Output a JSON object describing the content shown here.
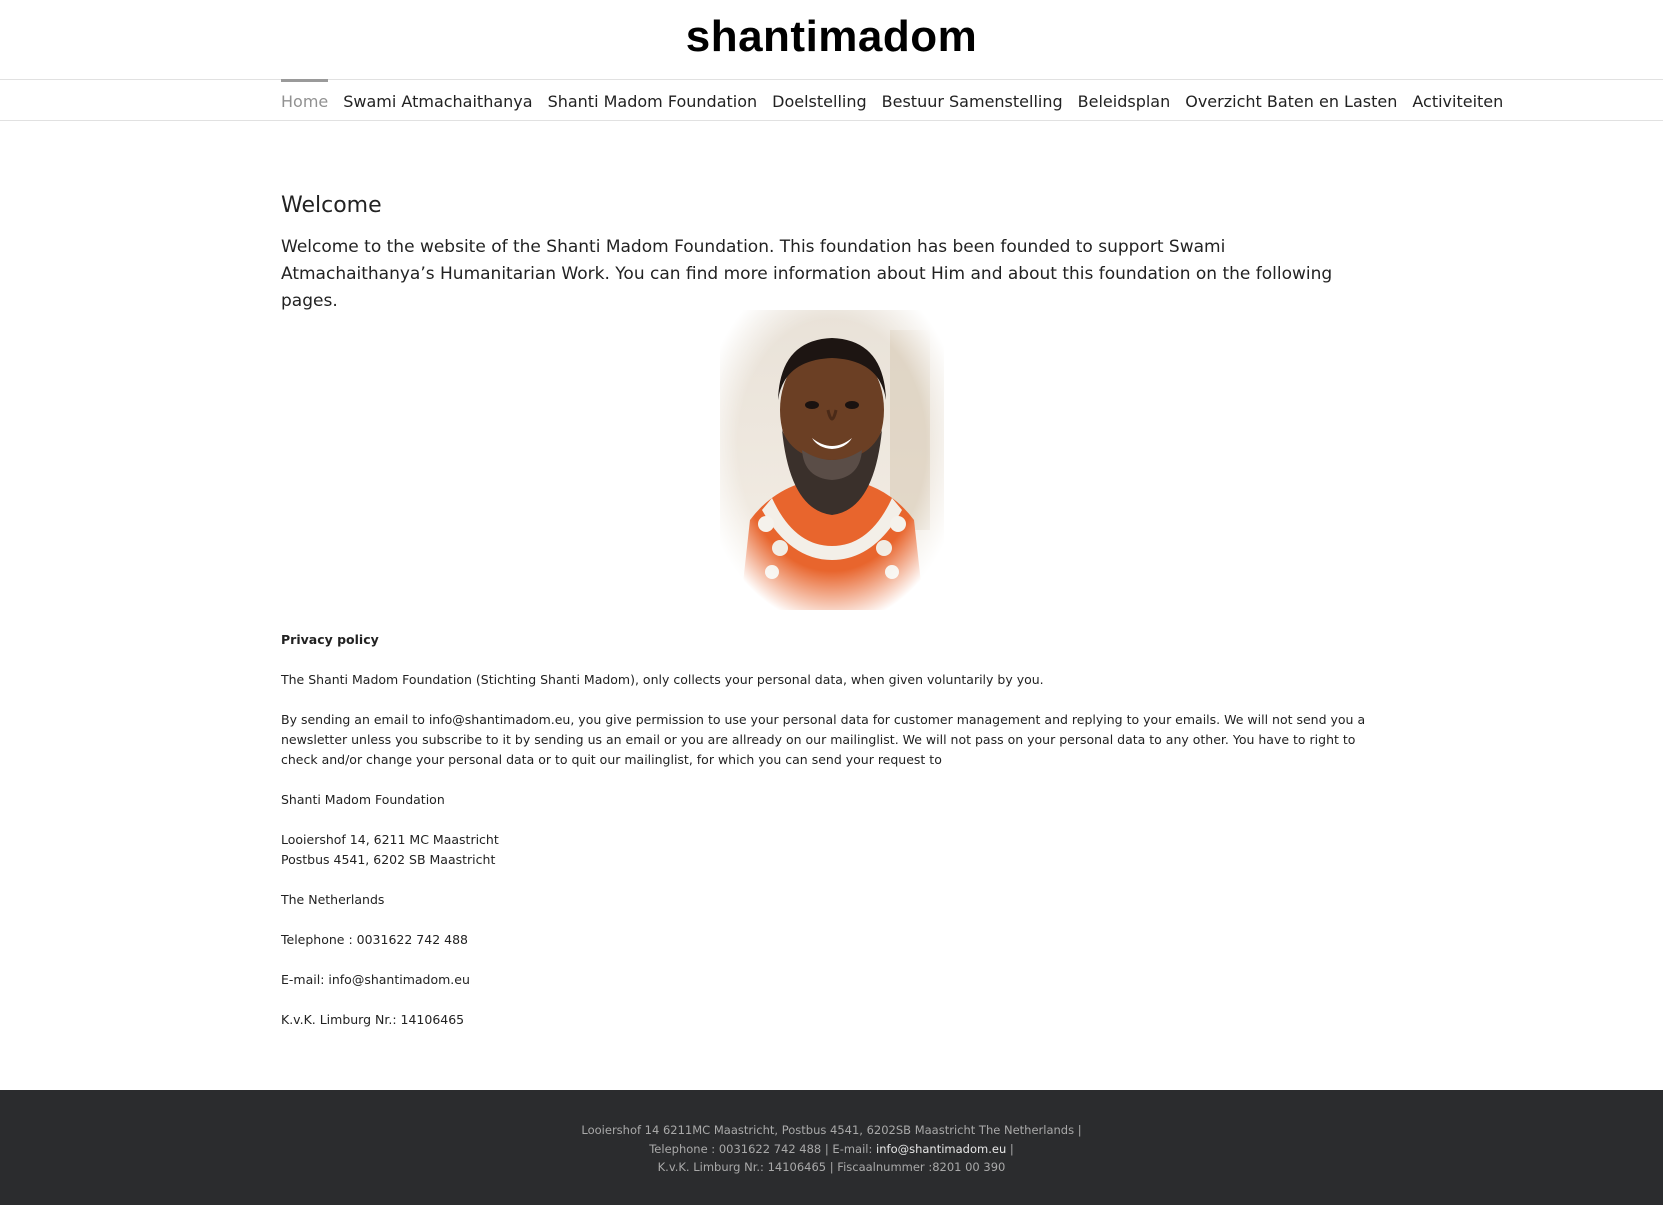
{
  "header": {
    "logo_text": "shantimadom"
  },
  "nav": {
    "items": [
      {
        "label": "Home",
        "active": true
      },
      {
        "label": "Swami Atmachaithanya"
      },
      {
        "label": "Shanti Madom Foundation"
      },
      {
        "label": "Doelstelling"
      },
      {
        "label": "Bestuur Samenstelling"
      },
      {
        "label": "Beleidsplan"
      },
      {
        "label": "Overzicht Baten en Lasten"
      },
      {
        "label": "Activiteiten"
      }
    ]
  },
  "main": {
    "title": "Welcome",
    "intro": "Welcome to the website of the Shanti Madom Foundation. This foundation has been founded to support Swami Atmachaithanya’s Humanitarian Work. You can find more information about Him and about this foundation on the following pages."
  },
  "privacy": {
    "heading": "Privacy policy",
    "p1": "The Shanti Madom Foundation (Stichting Shanti Madom), only collects your personal data, when given voluntarily by you.",
    "p2": "By sending an email to info@shantimadom.eu, you give permission to use your personal data for customer management and replying to your emails. We will not send you a newsletter unless you subscribe to it by sending us an email or you are allready on our mailinglist. We will not pass on your personal data to any other. You have to right to check and/or change your personal data or to quit our mailinglist, for which you can send your request to",
    "org": "Shanti Madom Foundation",
    "address1": "Looiershof 14, 6211 MC Maastricht",
    "address2": "Postbus 4541, 6202 SB Maastricht",
    "country": "The Netherlands",
    "telephone": "Telephone : 0031622 742 488",
    "email": "E-mail: info@shantimadom.eu",
    "kvk": "K.v.K. Limburg Nr.: 14106465"
  },
  "footer": {
    "line1": "Looiershof 14 6211MC Maastricht, Postbus 4541, 6202SB Maastricht The Netherlands |",
    "line2_prefix": "Telephone : 0031622 742 488 | E-mail: ",
    "line2_email": "info@shantimadom.eu",
    "line2_suffix": " |",
    "line3": "K.v.K. Limburg Nr.: 14106465 | Fiscaalnummer :8201 00 390"
  },
  "colors": {
    "footer_bg": "#2b2c2e",
    "nav_active": "#919191",
    "text": "#222222"
  }
}
